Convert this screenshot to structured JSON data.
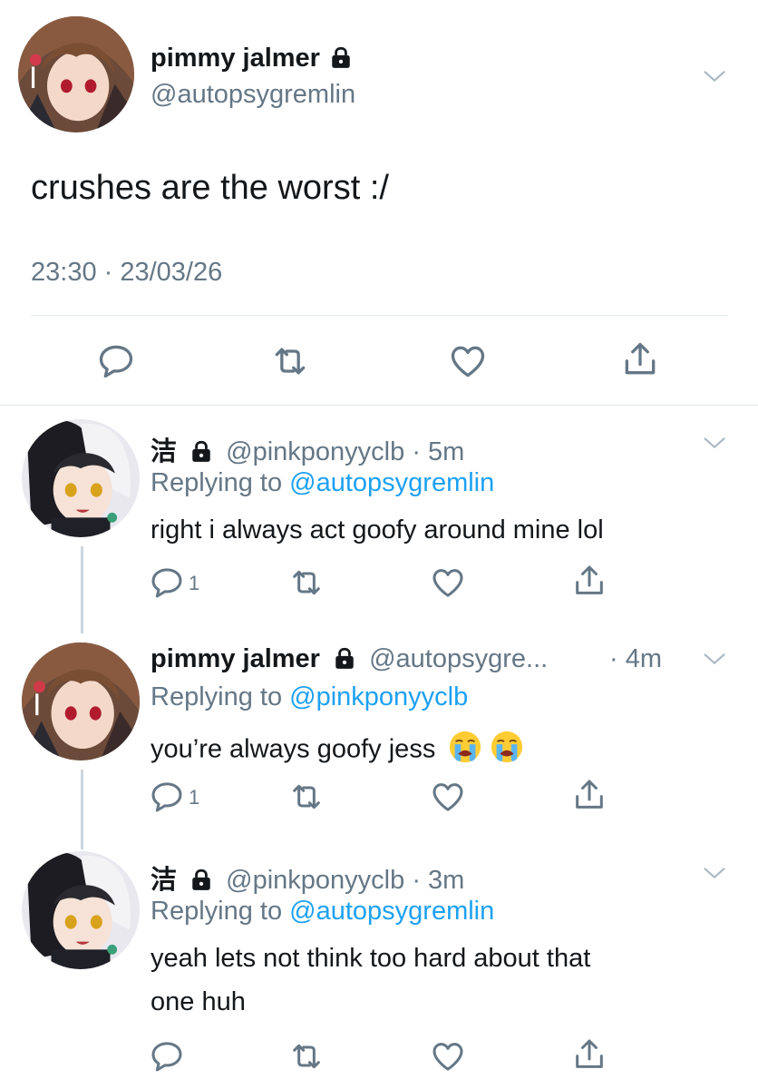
{
  "main_tweet": {
    "name": "pimmy jalmer",
    "handle": "@autopsygremlin",
    "text": "crushes are the worst :/",
    "timestamp": "23:30 · 23/03/26",
    "actions": [
      "reply-icon",
      "retweet-icon",
      "like-icon",
      "share-icon"
    ]
  },
  "replies": [
    {
      "name": "洁",
      "handle": "@pinkponyyclb",
      "time": "· 5m",
      "replying_prefix": "Replying to",
      "replying_to": "@autopsygremlin",
      "text": "right i always act goofy around mine lol",
      "reply_count": "1"
    },
    {
      "name": "pimmy jalmer",
      "handle": "@autopsygre...",
      "time": "· 4m",
      "replying_prefix": "Replying to",
      "replying_to": "@pinkponyyclb",
      "text": "you’re always goofy jess",
      "emoji": [
        "😭",
        "😭"
      ],
      "reply_count": "1"
    },
    {
      "name": "洁",
      "handle": "@pinkponyyclb",
      "time": "· 3m",
      "replying_prefix": "Replying to",
      "replying_to": "@autopsygremlin",
      "text_line1": "yeah lets not think too hard about that",
      "text_line2": "one huh"
    }
  ],
  "colors": {
    "text": "#14171a",
    "muted": "#657786",
    "link": "#1da1f2",
    "divider": "#e1e8ed",
    "thread_line": "#ccd6dd"
  }
}
